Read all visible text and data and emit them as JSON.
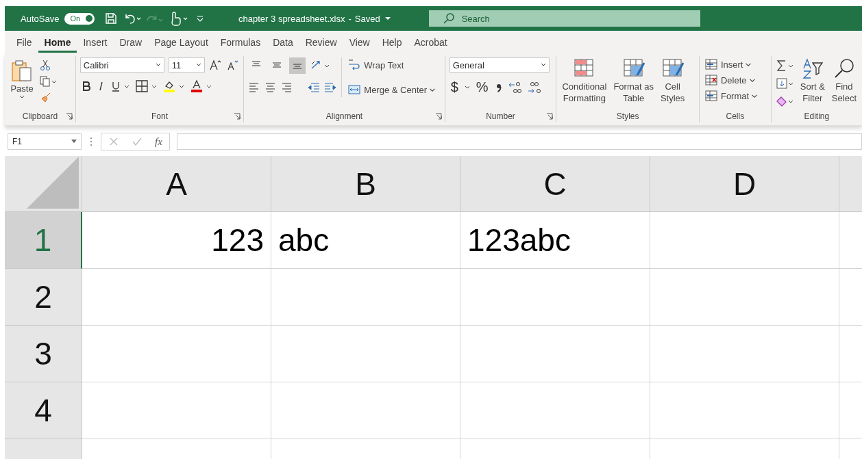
{
  "title_bar": {
    "autosave_label": "AutoSave",
    "autosave_toggle": {
      "label": "On",
      "on": true
    },
    "filename": "chapter 3 spreadsheet.xlsx",
    "separator": "-",
    "status": "Saved",
    "search": {
      "placeholder": "Search"
    }
  },
  "menu_tabs": [
    {
      "label": "File",
      "selected": false
    },
    {
      "label": "Home",
      "selected": true
    },
    {
      "label": "Insert",
      "selected": false
    },
    {
      "label": "Draw",
      "selected": false
    },
    {
      "label": "Page Layout",
      "selected": false
    },
    {
      "label": "Formulas",
      "selected": false
    },
    {
      "label": "Data",
      "selected": false
    },
    {
      "label": "Review",
      "selected": false
    },
    {
      "label": "View",
      "selected": false
    },
    {
      "label": "Help",
      "selected": false
    },
    {
      "label": "Acrobat",
      "selected": false
    }
  ],
  "ribbon": {
    "clipboard": {
      "paste": "Paste",
      "label": "Clipboard"
    },
    "font": {
      "font_name": "Calibri",
      "font_size": "11",
      "label": "Font"
    },
    "alignment": {
      "vertical_align": [
        {
          "selected": false
        },
        {
          "selected": false
        },
        {
          "selected": true
        }
      ],
      "wrap_text": "Wrap Text",
      "merge": "Merge & Center",
      "label": "Alignment"
    },
    "number": {
      "format": "General",
      "currency": "$",
      "percent": "%",
      "label": "Number"
    },
    "styles": {
      "buttons": [
        {
          "lines": [
            "Conditional",
            "Formatting"
          ]
        },
        {
          "lines": [
            "Format as",
            "Table"
          ]
        },
        {
          "lines": [
            "Cell",
            "Styles"
          ]
        }
      ],
      "label": "Styles"
    },
    "cells": {
      "buttons": [
        "Insert",
        "Delete",
        "Format"
      ],
      "label": "Cells"
    },
    "editing": {
      "buttons": [
        {
          "lines": [
            "Sort &",
            "Filter"
          ]
        },
        {
          "lines": [
            "Find",
            "Select"
          ]
        }
      ],
      "label": "Editing"
    }
  },
  "formula_bar": {
    "name_box": "F1",
    "fx": "fx"
  },
  "grid": {
    "columns": [
      "A",
      "B",
      "C",
      "D"
    ],
    "rows": [
      {
        "label": "1",
        "selected": true,
        "cells": [
          {
            "kind": "number",
            "value": "123"
          },
          {
            "kind": "text",
            "value": "abc"
          },
          {
            "kind": "text",
            "value": "123abc"
          }
        ]
      },
      {
        "label": "2",
        "selected": false,
        "cells": []
      },
      {
        "label": "3",
        "selected": false,
        "cells": []
      },
      {
        "label": "4",
        "selected": false,
        "cells": []
      }
    ]
  }
}
